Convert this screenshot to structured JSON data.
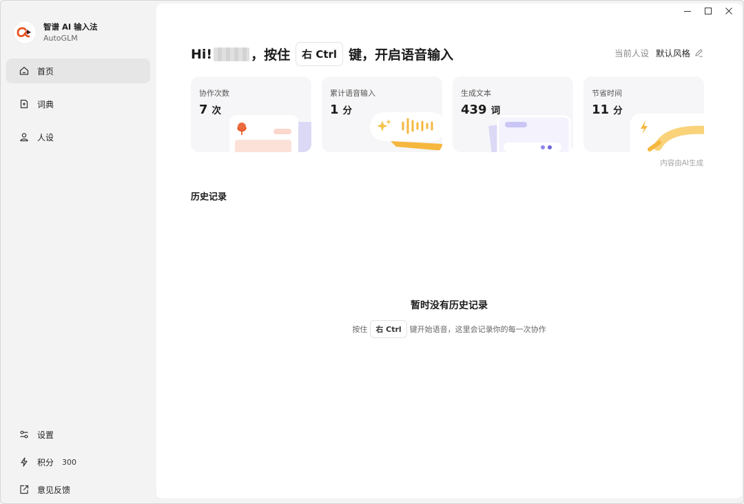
{
  "app": {
    "name": "智谱 AI 输入法",
    "subtitle": "AutoGLM"
  },
  "sidebar": {
    "items": [
      {
        "label": "首页",
        "icon": "home-icon",
        "active": true
      },
      {
        "label": "词典",
        "icon": "dictionary-icon",
        "active": false
      },
      {
        "label": "人设",
        "icon": "person-icon",
        "active": false
      }
    ],
    "bottom": {
      "settings": "设置",
      "points_label": "积分",
      "points_value": "300",
      "feedback": "意见反馈"
    }
  },
  "header": {
    "greeting": "Hi!",
    "hold": "，按住",
    "key": "右 Ctrl",
    "rest": "键，开启语音输入",
    "persona_label": "当前人设",
    "persona_value": "默认风格"
  },
  "stats": [
    {
      "title": "协作次数",
      "value": "7",
      "unit": "次"
    },
    {
      "title": "累计语音输入",
      "value": "1",
      "unit": "分"
    },
    {
      "title": "生成文本",
      "value": "439",
      "unit": "词"
    },
    {
      "title": "节省时间",
      "value": "11",
      "unit": "分"
    }
  ],
  "ai_note": "内容由AI生成",
  "history": {
    "title": "历史记录",
    "empty_title": "暂时没有历史记录",
    "empty_pre": "按住",
    "empty_key": "右 Ctrl",
    "empty_post": "键开始语音，这里会记录你的每一次协作"
  },
  "colors": {
    "brand": "#e8501c",
    "accent_purple": "#8e86f0",
    "accent_yellow": "#f5b73d"
  }
}
